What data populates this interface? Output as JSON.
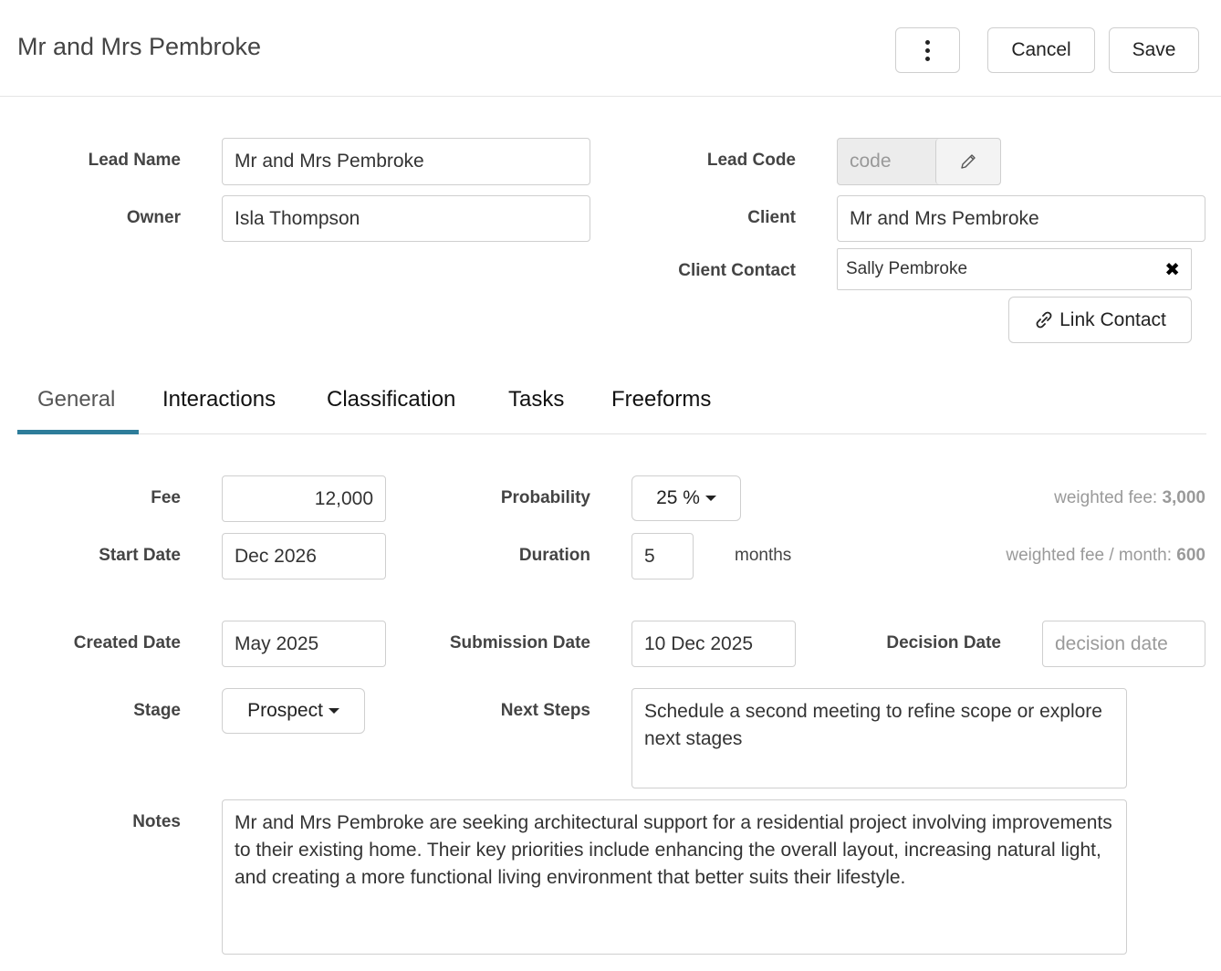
{
  "header": {
    "title": "Mr and Mrs Pembroke",
    "cancel_label": "Cancel",
    "save_label": "Save"
  },
  "form": {
    "lead_name": {
      "label": "Lead Name",
      "value": "Mr and Mrs Pembroke"
    },
    "owner": {
      "label": "Owner",
      "value": "Isla Thompson"
    },
    "lead_code": {
      "label": "Lead Code",
      "placeholder": "code"
    },
    "client": {
      "label": "Client",
      "value": "Mr and Mrs Pembroke"
    },
    "client_contact": {
      "label": "Client Contact",
      "value": "Sally Pembroke",
      "clear_glyph": "✖"
    },
    "link_contact_label": "Link Contact"
  },
  "tabs": [
    {
      "label": "General",
      "active": true
    },
    {
      "label": "Interactions",
      "active": false
    },
    {
      "label": "Classification",
      "active": false
    },
    {
      "label": "Tasks",
      "active": false
    },
    {
      "label": "Freeforms",
      "active": false
    }
  ],
  "general": {
    "fee": {
      "label": "Fee",
      "value": "12,000"
    },
    "probability": {
      "label": "Probability",
      "value": "25 %"
    },
    "weighted_fee": {
      "label": "weighted fee:",
      "value": "3,000"
    },
    "start_date": {
      "label": "Start Date",
      "value": "Dec 2026"
    },
    "duration": {
      "label": "Duration",
      "value": "5",
      "unit": "months"
    },
    "weighted_fee_month": {
      "label": "weighted fee / month:",
      "value": "600"
    },
    "created_date": {
      "label": "Created Date",
      "value": "May 2025"
    },
    "submission_date": {
      "label": "Submission Date",
      "value": "10 Dec 2025"
    },
    "decision_date": {
      "label": "Decision Date",
      "placeholder": "decision date"
    },
    "stage": {
      "label": "Stage",
      "value": "Prospect"
    },
    "next_steps": {
      "label": "Next Steps",
      "value": "Schedule a second meeting to refine scope or explore next stages"
    },
    "notes": {
      "label": "Notes",
      "value": "Mr and Mrs Pembroke are seeking architectural support for a residential project involving improvements to their existing home. Their key priorities include enhancing the overall layout, increasing natural light, and creating a more functional living environment that better suits their lifestyle."
    }
  },
  "colors": {
    "accent": "#2e7d9a"
  },
  "icons": {
    "menu": "kebab-icon",
    "edit": "pencil-icon",
    "link": "link-icon",
    "clear": "close-icon"
  }
}
